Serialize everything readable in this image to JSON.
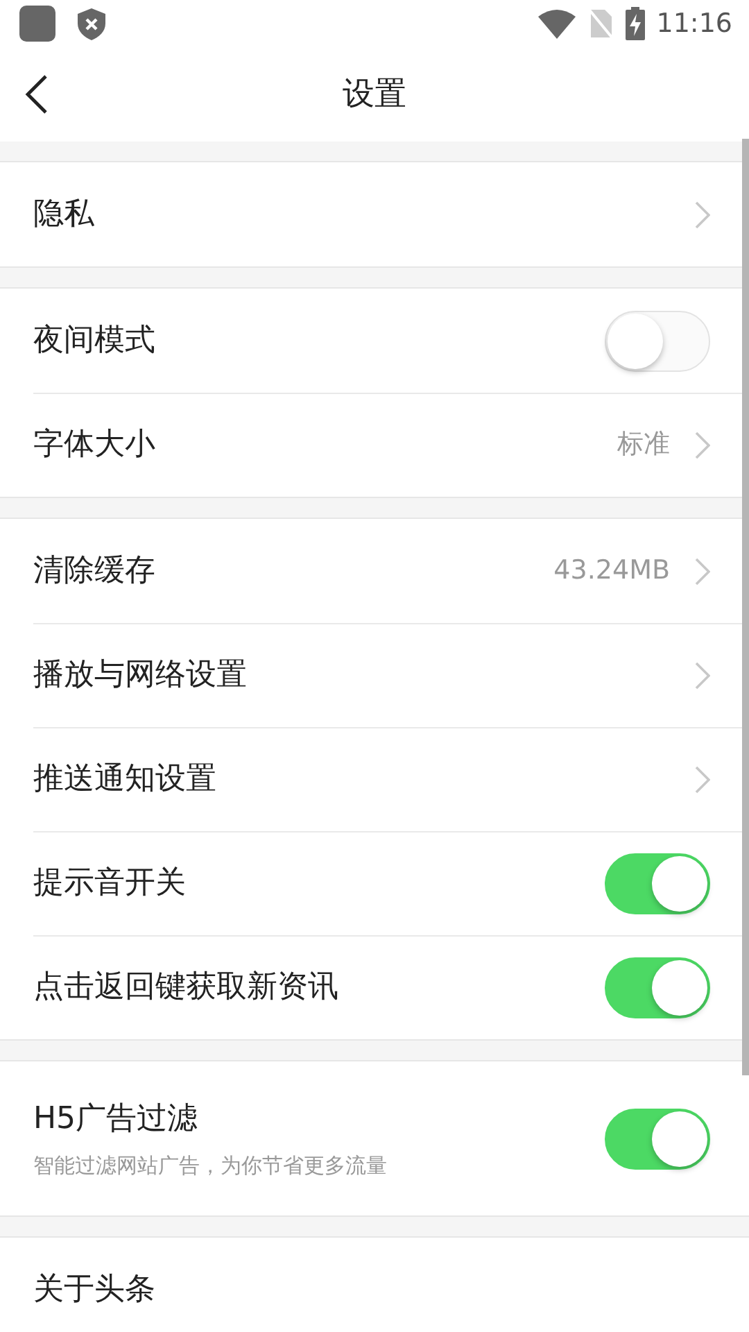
{
  "status_bar": {
    "time": "11:16"
  },
  "header": {
    "title": "设置"
  },
  "groups": [
    {
      "items": [
        {
          "kind": "link",
          "label": "隐私"
        }
      ]
    },
    {
      "items": [
        {
          "kind": "toggle",
          "label": "夜间模式",
          "on": false
        },
        {
          "kind": "link",
          "label": "字体大小",
          "value": "标准"
        }
      ]
    },
    {
      "items": [
        {
          "kind": "link",
          "label": "清除缓存",
          "value": "43.24MB"
        },
        {
          "kind": "link",
          "label": "播放与网络设置"
        },
        {
          "kind": "link",
          "label": "推送通知设置"
        },
        {
          "kind": "toggle",
          "label": "提示音开关",
          "on": true
        },
        {
          "kind": "toggle",
          "label": "点击返回键获取新资讯",
          "on": true
        }
      ]
    },
    {
      "items": [
        {
          "kind": "toggle",
          "label": "H5广告过滤",
          "subtitle": "智能过滤网站广告，为你节省更多流量",
          "on": true
        }
      ]
    },
    {
      "items": [
        {
          "kind": "plain",
          "label": "关于头条"
        }
      ]
    }
  ]
}
